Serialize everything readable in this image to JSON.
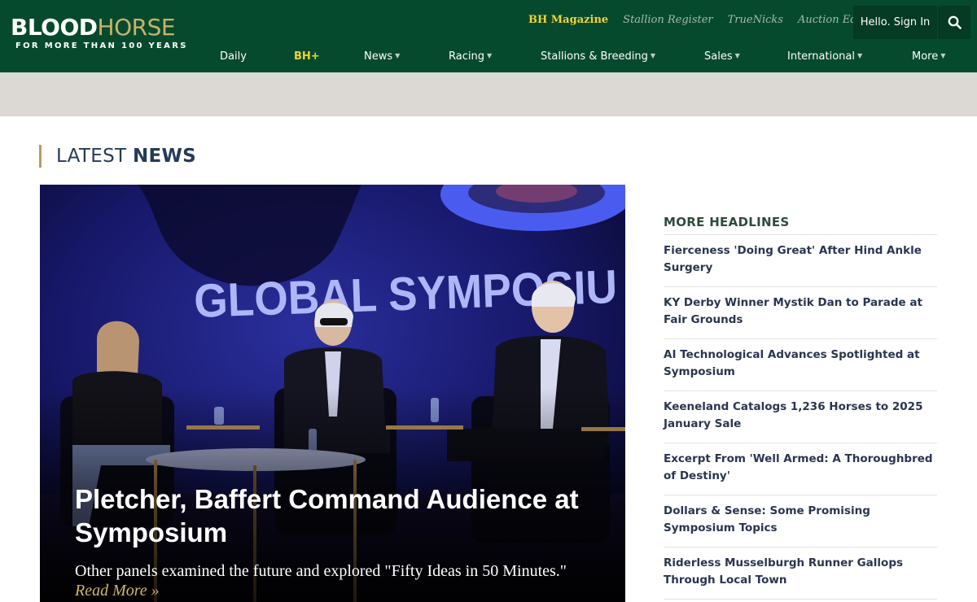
{
  "logo": {
    "blood": "BLOOD",
    "horse": "HORSE",
    "tagline": "FOR MORE THAN 100 YEARS"
  },
  "toplinks": [
    {
      "label": "BH Magazine"
    },
    {
      "label": "Stallion Register"
    },
    {
      "label": "TrueNicks"
    },
    {
      "label": "Auction Edge"
    }
  ],
  "header": {
    "signin_label": "Hello. Sign In",
    "search_icon": "search-icon"
  },
  "nav": [
    {
      "label": "Daily",
      "dropdown": false
    },
    {
      "label": "BH+",
      "dropdown": false
    },
    {
      "label": "News",
      "dropdown": true
    },
    {
      "label": "Racing",
      "dropdown": true
    },
    {
      "label": "Stallions & Breeding",
      "dropdown": true
    },
    {
      "label": "Sales",
      "dropdown": true
    },
    {
      "label": "International",
      "dropdown": true
    },
    {
      "label": "More",
      "dropdown": true
    }
  ],
  "latest": {
    "prefix": "LATEST",
    "emphasis": "NEWS"
  },
  "hero": {
    "banner_text": "GLOBAL SYMPOSIU",
    "title": "Pletcher, Baffert Command Audience at Symposium",
    "subtitle": "Other panels examined the future and explored \"Fifty Ideas in 50 Minutes.\"",
    "read_more": "Read More »"
  },
  "more_headlines": {
    "title": "MORE HEADLINES",
    "items": [
      "Fierceness 'Doing Great' After Hind Ankle Surgery",
      "KY Derby Winner Mystik Dan to Parade at Fair Grounds",
      "AI Technological Advances Spotlighted at Symposium",
      "Keeneland Catalogs 1,236 Horses to 2025 January Sale",
      "Excerpt From 'Well Armed: A Thoroughbred of Destiny'",
      "Dollars & Sense: Some Promising Symposium Topics",
      "Riderless Musselburgh Runner Gallops Through Local Town"
    ]
  },
  "colors": {
    "header_bg": "#064a2e",
    "gold": "#c9b26b",
    "bh_yellow": "#f0d23b",
    "headline_text": "#2a3550",
    "ad_band": "#dcd8d3"
  }
}
